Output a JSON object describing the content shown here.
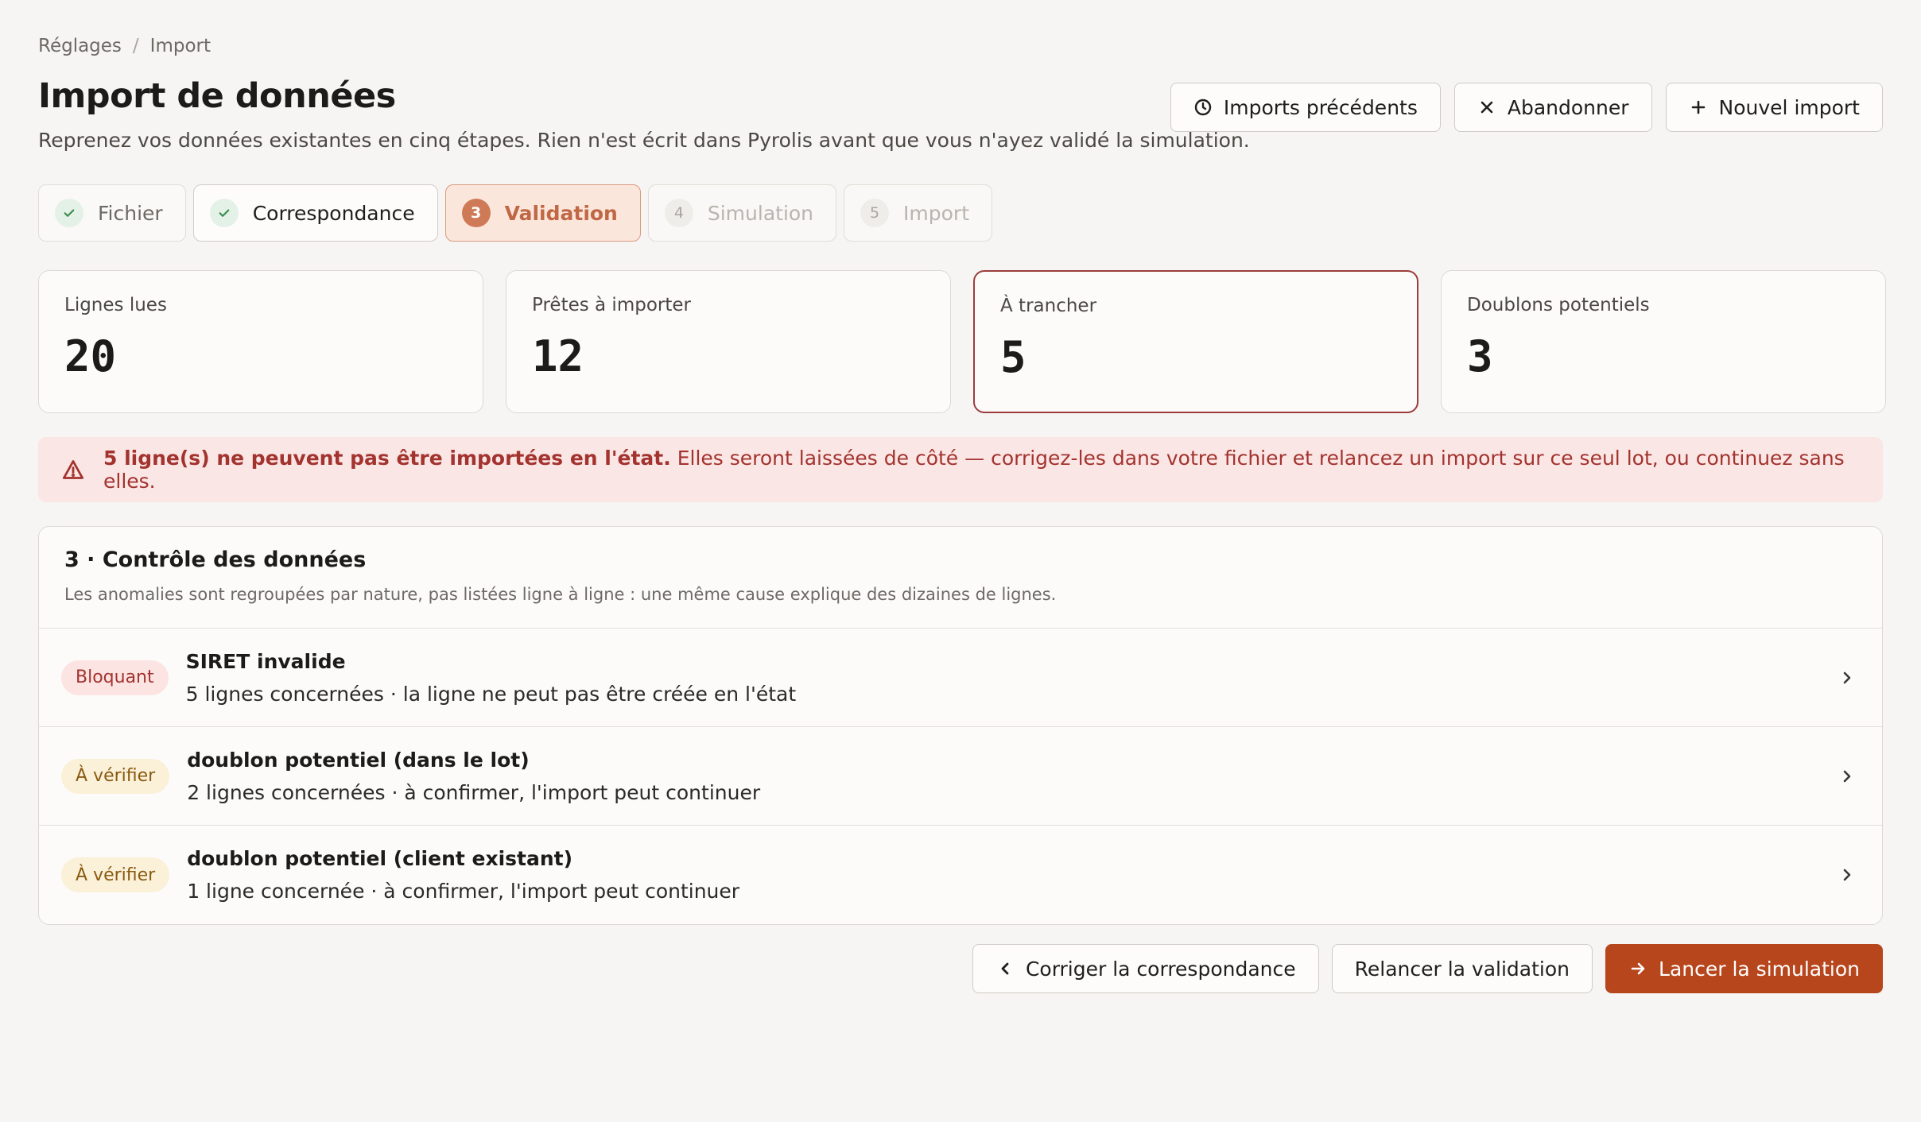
{
  "breadcrumb": {
    "items": [
      "Réglages",
      "Import"
    ],
    "separator": "/"
  },
  "header": {
    "title": "Import de données",
    "subtitle": "Reprenez vos données existantes en cinq étapes. Rien n'est écrit dans Pyrolis avant que vous n'ayez validé la simulation.",
    "actions": {
      "history": "Imports précédents",
      "abandon": "Abandonner",
      "new_import": "Nouvel import"
    }
  },
  "stepper": [
    {
      "label": "Fichier",
      "state": "done"
    },
    {
      "label": "Correspondance",
      "state": "done"
    },
    {
      "number": "3",
      "label": "Validation",
      "state": "active"
    },
    {
      "number": "4",
      "label": "Simulation",
      "state": "todo"
    },
    {
      "number": "5",
      "label": "Import",
      "state": "todo"
    }
  ],
  "stats": [
    {
      "label": "Lignes lues",
      "value": "20"
    },
    {
      "label": "Prêtes à importer",
      "value": "12"
    },
    {
      "label": "À trancher",
      "value": "5"
    },
    {
      "label": "Doublons potentiels",
      "value": "3"
    }
  ],
  "alert": {
    "strong": "5 ligne(s) ne peuvent pas être importées en l'état.",
    "text": "Elles seront laissées de côté — corrigez-les dans votre fichier et relancez un import sur ce seul lot, ou continuez sans elles."
  },
  "panel": {
    "title": "3 · Contrôle des données",
    "description": "Les anomalies sont regroupées par nature, pas listées ligne à ligne : une même cause explique des dizaines de lignes.",
    "rows": [
      {
        "badge": "Bloquant",
        "title": "SIRET invalide",
        "detail": "5 lignes concernées · la ligne ne peut pas être créée en l'état"
      },
      {
        "badge": "À vérifier",
        "title": "doublon potentiel (dans le lot)",
        "detail": "2 lignes concernées · à confirmer, l'import peut continuer"
      },
      {
        "badge": "À vérifier",
        "title": "doublon potentiel (client existant)",
        "detail": "1 ligne concernée · à confirmer, l'import peut continuer"
      }
    ]
  },
  "footer": {
    "back": "Corriger la correspondance",
    "rerun": "Relancer la validation",
    "next": "Lancer la simulation"
  },
  "colors": {
    "primary": "#b7461d",
    "danger": "#a3332f",
    "warning_badge": "#fbf0d8",
    "success_dot": "#e4f1e6",
    "active_step": "#fbe6dc"
  },
  "icons": {
    "history": "clock-icon",
    "abandon": "close-icon",
    "new_import": "plus-icon",
    "step_done": "check-icon",
    "alert": "warning-triangle-icon",
    "row": "chevron-right-icon",
    "back": "chevron-left-icon",
    "next": "arrow-right-icon"
  }
}
